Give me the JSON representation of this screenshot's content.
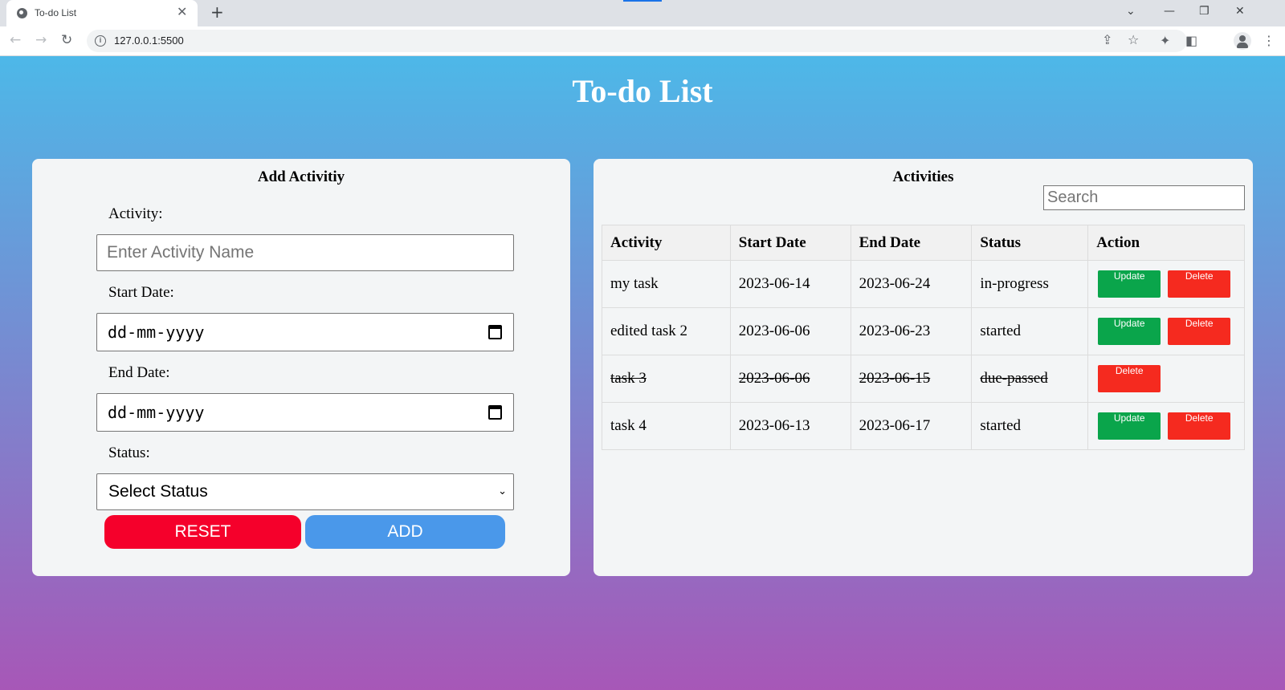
{
  "browser": {
    "tab_title": "To-do List",
    "url": "127.0.0.1:5500"
  },
  "page": {
    "title": "To-do List"
  },
  "add_form": {
    "heading": "Add Activitiy",
    "activity_label": "Activity:",
    "activity_placeholder": "Enter Activity Name",
    "start_label": "Start Date:",
    "start_value": "dd-mm-yyyy",
    "end_label": "End Date:",
    "end_value": "dd-mm-yyyy",
    "status_label": "Status:",
    "status_selected": "Select Status",
    "reset_label": "RESET",
    "add_label": "ADD",
    "reset_color": "#f5002b",
    "add_color": "#4a98ea"
  },
  "activities": {
    "heading": "Activities",
    "search_placeholder": "Search",
    "columns": [
      "Activity",
      "Start Date",
      "End Date",
      "Status",
      "Action"
    ],
    "rows": [
      {
        "activity": "my task",
        "start": "2023-06-14",
        "end": "2023-06-24",
        "status": "in-progress",
        "update_label": "Update",
        "delete_label": "Delete"
      },
      {
        "activity": "edited task 2",
        "start": "2023-06-06",
        "end": "2023-06-23",
        "status": "started",
        "update_label": "Update",
        "delete_label": "Delete"
      },
      {
        "activity": "task 3",
        "start": "2023-06-06",
        "end": "2023-06-15",
        "status": "due-passed",
        "delete_label": "Delete"
      },
      {
        "activity": "task 4",
        "start": "2023-06-13",
        "end": "2023-06-17",
        "status": "started",
        "update_label": "Update",
        "delete_label": "Delete"
      }
    ],
    "update_color": "#0aa54b",
    "delete_color": "#f52a1f"
  },
  "icons": {
    "tab": "globe-icon",
    "tab_close": "close-icon",
    "new_tab": "plus-icon",
    "back": "arrow-left-icon",
    "forward": "arrow-right-icon",
    "reload": "reload-icon",
    "site_info": "info-icon",
    "share": "share-icon",
    "bookmark": "star-icon",
    "extensions": "puzzle-icon",
    "side_panel": "side-panel-icon",
    "profile": "avatar-icon",
    "menu": "kebab-menu-icon",
    "calendar": "calendar-icon",
    "select": "chevron-down-icon"
  }
}
